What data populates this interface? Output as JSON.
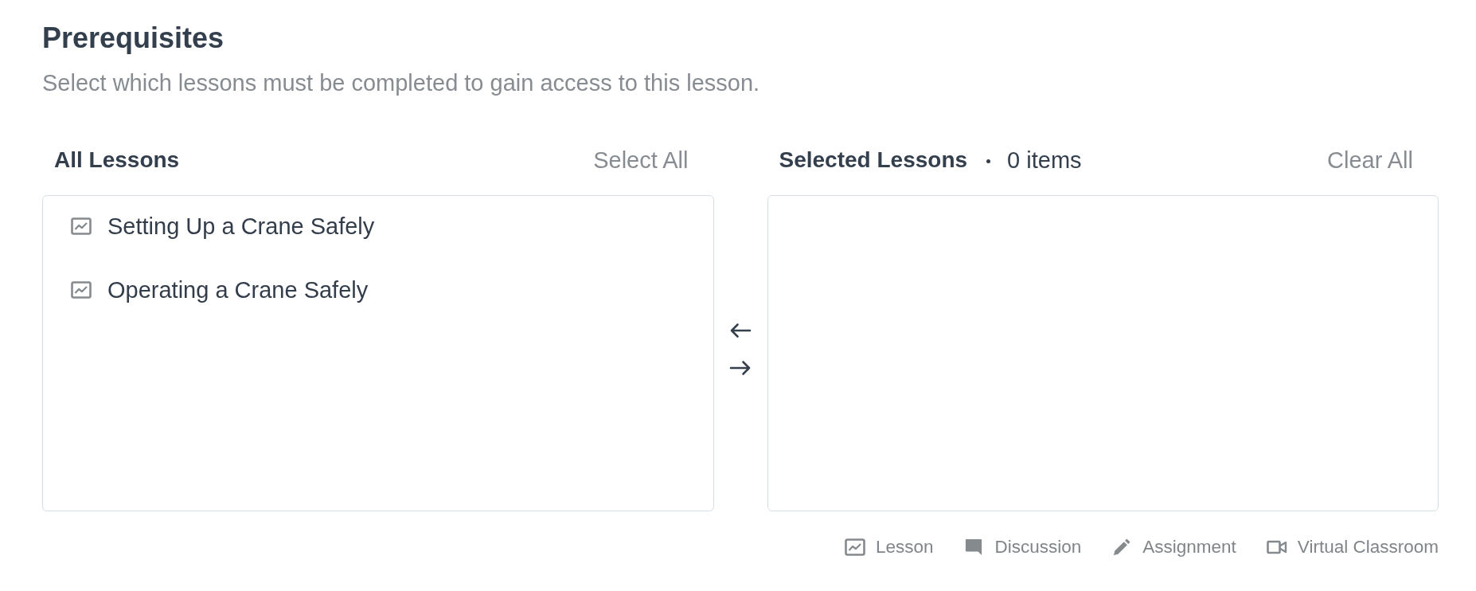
{
  "header": {
    "title": "Prerequisites",
    "description": "Select which lessons must be completed to gain access to this lesson."
  },
  "panels": [
    {
      "title": "All Lessons",
      "action": "Select All",
      "items": [
        {
          "kind": "lesson",
          "label": "Setting Up a Crane Safely"
        },
        {
          "kind": "lesson",
          "label": "Operating a Crane Safely"
        }
      ]
    },
    {
      "title": "Selected Lessons",
      "count": "0 items",
      "action": "Clear All"
    }
  ],
  "legend": [
    {
      "kind": "lesson",
      "label": "Lesson"
    },
    {
      "kind": "discussion",
      "label": "Discussion"
    },
    {
      "kind": "assignment",
      "label": "Assignment"
    },
    {
      "kind": "virtual_classroom",
      "label": "Virtual Classroom"
    }
  ]
}
